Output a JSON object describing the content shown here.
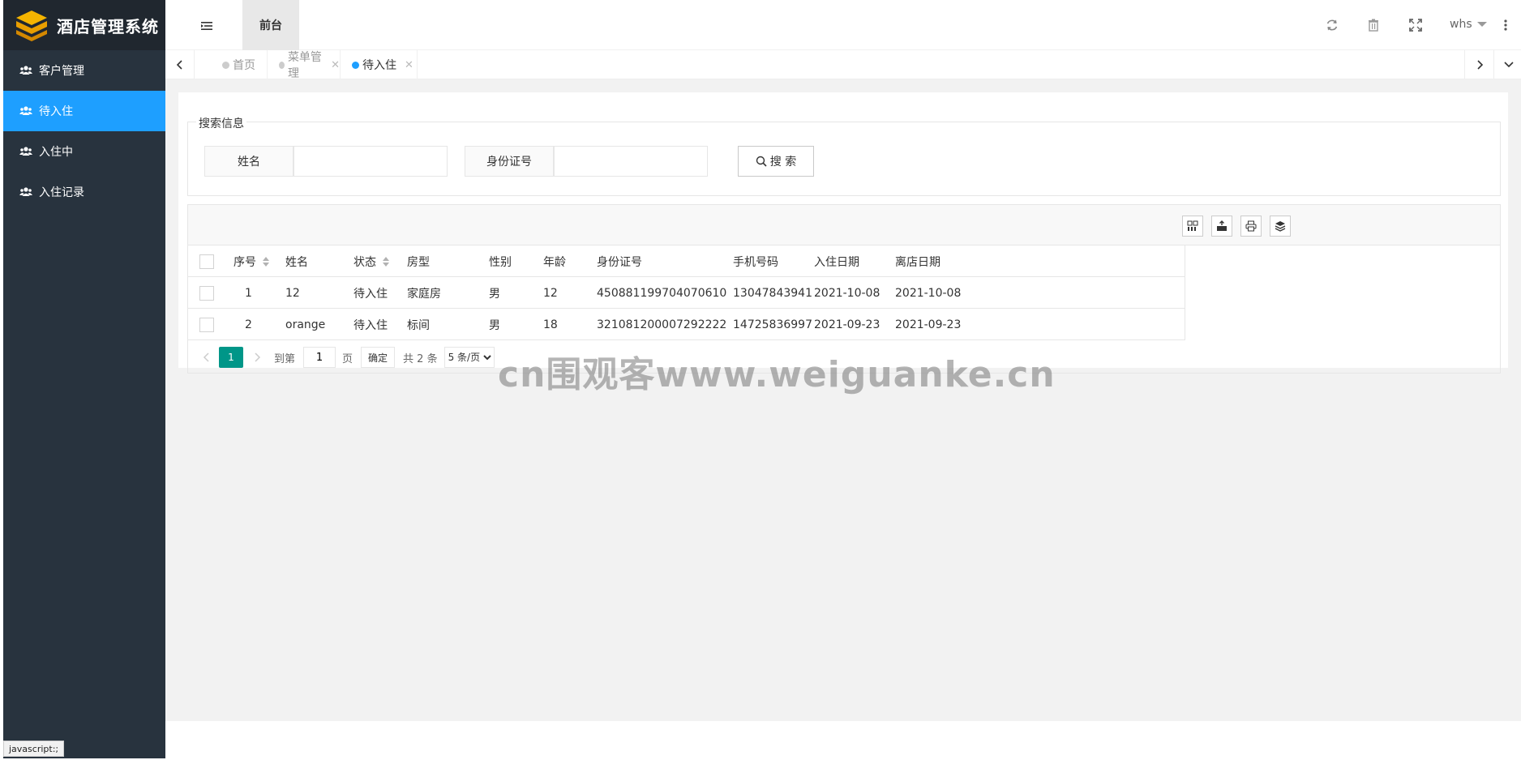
{
  "app": {
    "title": "酒店管理系统",
    "colors": {
      "sidebar": "#28333e",
      "active": "#1e9fff",
      "pager": "#009688"
    }
  },
  "sidebar": {
    "items": [
      {
        "label": "客户管理",
        "icon": "users-icon",
        "active": false
      },
      {
        "label": "待入住",
        "icon": "users-icon",
        "active": true
      },
      {
        "label": "入住中",
        "icon": "users-icon",
        "active": false
      },
      {
        "label": "入住记录",
        "icon": "users-icon",
        "active": false
      }
    ]
  },
  "header": {
    "top_tab": "前台",
    "user": "whs"
  },
  "tabs": [
    {
      "label": "首页",
      "closable": false,
      "active": false
    },
    {
      "label": "菜单管理",
      "closable": true,
      "active": false
    },
    {
      "label": "待入住",
      "closable": true,
      "active": true
    }
  ],
  "search": {
    "legend": "搜索信息",
    "name_label": "姓名",
    "name_value": "",
    "id_label": "身份证号",
    "id_value": "",
    "button": "搜 索"
  },
  "table": {
    "columns": [
      "序号",
      "姓名",
      "状态",
      "房型",
      "性别",
      "年龄",
      "身份证号",
      "手机号码",
      "入住日期",
      "离店日期"
    ],
    "rows": [
      [
        "1",
        "12",
        "待入住",
        "家庭房",
        "男",
        "12",
        "450881199704070610",
        "13047843941",
        "2021-10-08",
        "2021-10-08"
      ],
      [
        "2",
        "orange",
        "待入住",
        "标间",
        "男",
        "18",
        "321081200007292222",
        "14725836997",
        "2021-09-23",
        "2021-09-23"
      ]
    ]
  },
  "pager": {
    "current": "1",
    "goto_label": "到第",
    "goto_value": "1",
    "page_label": "页",
    "confirm": "确定",
    "total": "共 2 条",
    "per_page": "5 条/页"
  },
  "watermark": "cn围观客www.weiguanke.cn",
  "status_bar": "javascript:;"
}
